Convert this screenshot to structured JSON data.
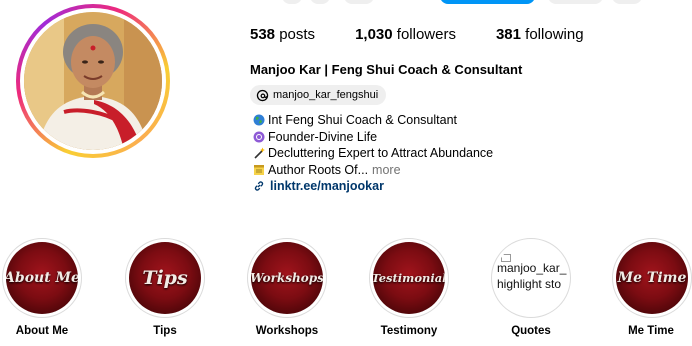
{
  "profile": {
    "stats": {
      "posts_count": "538",
      "posts_label": "posts",
      "followers_count": "1,030",
      "followers_label": "followers",
      "following_count": "381",
      "following_label": "following"
    },
    "name": "Manjoo Kar | Feng Shui Coach & Consultant",
    "threads_handle": "manjoo_kar_fengshui",
    "bio": [
      {
        "icon": "globe-emoji",
        "text": "Int Feng Shui Coach & Consultant"
      },
      {
        "icon": "purple-circle-emoji",
        "text": "Founder-Divine Life"
      },
      {
        "icon": "magic-wand-emoji",
        "text": "Decluttering Expert to Attract Abundance"
      },
      {
        "icon": "notepad-emoji",
        "text": "Author Roots Of...",
        "more": "more"
      }
    ],
    "link": "linktr.ee/manjookar"
  },
  "highlights": [
    {
      "title": "About Me",
      "label": "About Me",
      "broken": false
    },
    {
      "title": "Tips",
      "label": "Tips",
      "broken": false
    },
    {
      "title": "Workshops",
      "label": "Workshops",
      "broken": false
    },
    {
      "title": "Testimonial",
      "label": "Testimony",
      "broken": false
    },
    {
      "title": "",
      "label": "Quotes",
      "broken": true,
      "alt_line1": "manjoo_kar_",
      "alt_line2": "highlight sto"
    },
    {
      "title": "Me Time",
      "label": "Me Time",
      "broken": false
    }
  ],
  "colors": {
    "link": "#00376b",
    "muted": "#737373",
    "chip_bg": "#efefef",
    "primary_button": "#0095f6",
    "highlight_red": "#7c0c12"
  }
}
